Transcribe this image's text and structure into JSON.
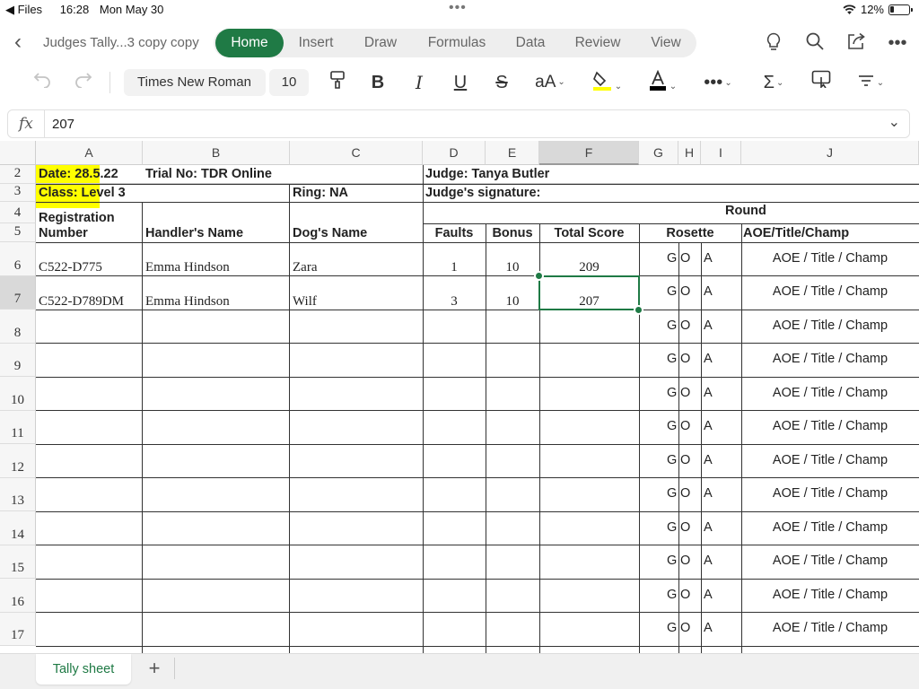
{
  "status_bar": {
    "back_app": "Files",
    "time": "16:28",
    "date": "Mon May 30",
    "battery": "12%"
  },
  "header": {
    "doc_title": "Judges Tally...3 copy copy",
    "tabs": [
      {
        "label": "Home",
        "active": true
      },
      {
        "label": "Insert"
      },
      {
        "label": "Draw"
      },
      {
        "label": "Formulas"
      },
      {
        "label": "Data"
      },
      {
        "label": "Review"
      },
      {
        "label": "View"
      }
    ],
    "icons": [
      "lightbulb-icon",
      "search-icon",
      "share-icon",
      "more-icon"
    ]
  },
  "toolbar": {
    "font_name": "Times New Roman",
    "font_size": "10",
    "accent_color": "#1f7a45"
  },
  "formula_bar": {
    "fx_label": "fx",
    "value": "207"
  },
  "columns": [
    "A",
    "B",
    "C",
    "D",
    "E",
    "F",
    "G",
    "H",
    "I",
    "J"
  ],
  "rows": [
    "2",
    "3",
    "4",
    "5",
    "6",
    "7",
    "8",
    "9",
    "10",
    "11",
    "12",
    "13",
    "14",
    "15",
    "16",
    "17"
  ],
  "sheet": {
    "date": "Date: 28.5.22",
    "trial": "Trial No: TDR Online",
    "judge": "Judge: Tanya Butler",
    "class": "Class: Level 3",
    "ring": "Ring: NA",
    "signature": "Judge's signature:",
    "round": "Round",
    "hdr_reg_1": "Registration",
    "hdr_reg_2": "Number",
    "hdr_handler": "Handler's Name",
    "hdr_dog": "Dog's Name",
    "hdr_faults": "Faults",
    "hdr_bonus": "Bonus",
    "hdr_total": "Total Score",
    "hdr_rosette": "Rosette",
    "hdr_aoe": "AOE/Title/Champ",
    "entries": [
      {
        "reg": "C522-D775",
        "handler": "Emma Hindson",
        "dog": "Zara",
        "faults": "1",
        "bonus": "10",
        "total": "209"
      },
      {
        "reg": "C522-D789DM",
        "handler": "Emma Hindson",
        "dog": "Wilf",
        "faults": "3",
        "bonus": "10",
        "total": "207"
      }
    ],
    "rosette_g": "G",
    "rosette_o": "O",
    "rosette_a": "A",
    "aoe_text": "AOE / Title / Champ"
  },
  "sheet_tabs": {
    "active": "Tally sheet",
    "add": "+"
  }
}
